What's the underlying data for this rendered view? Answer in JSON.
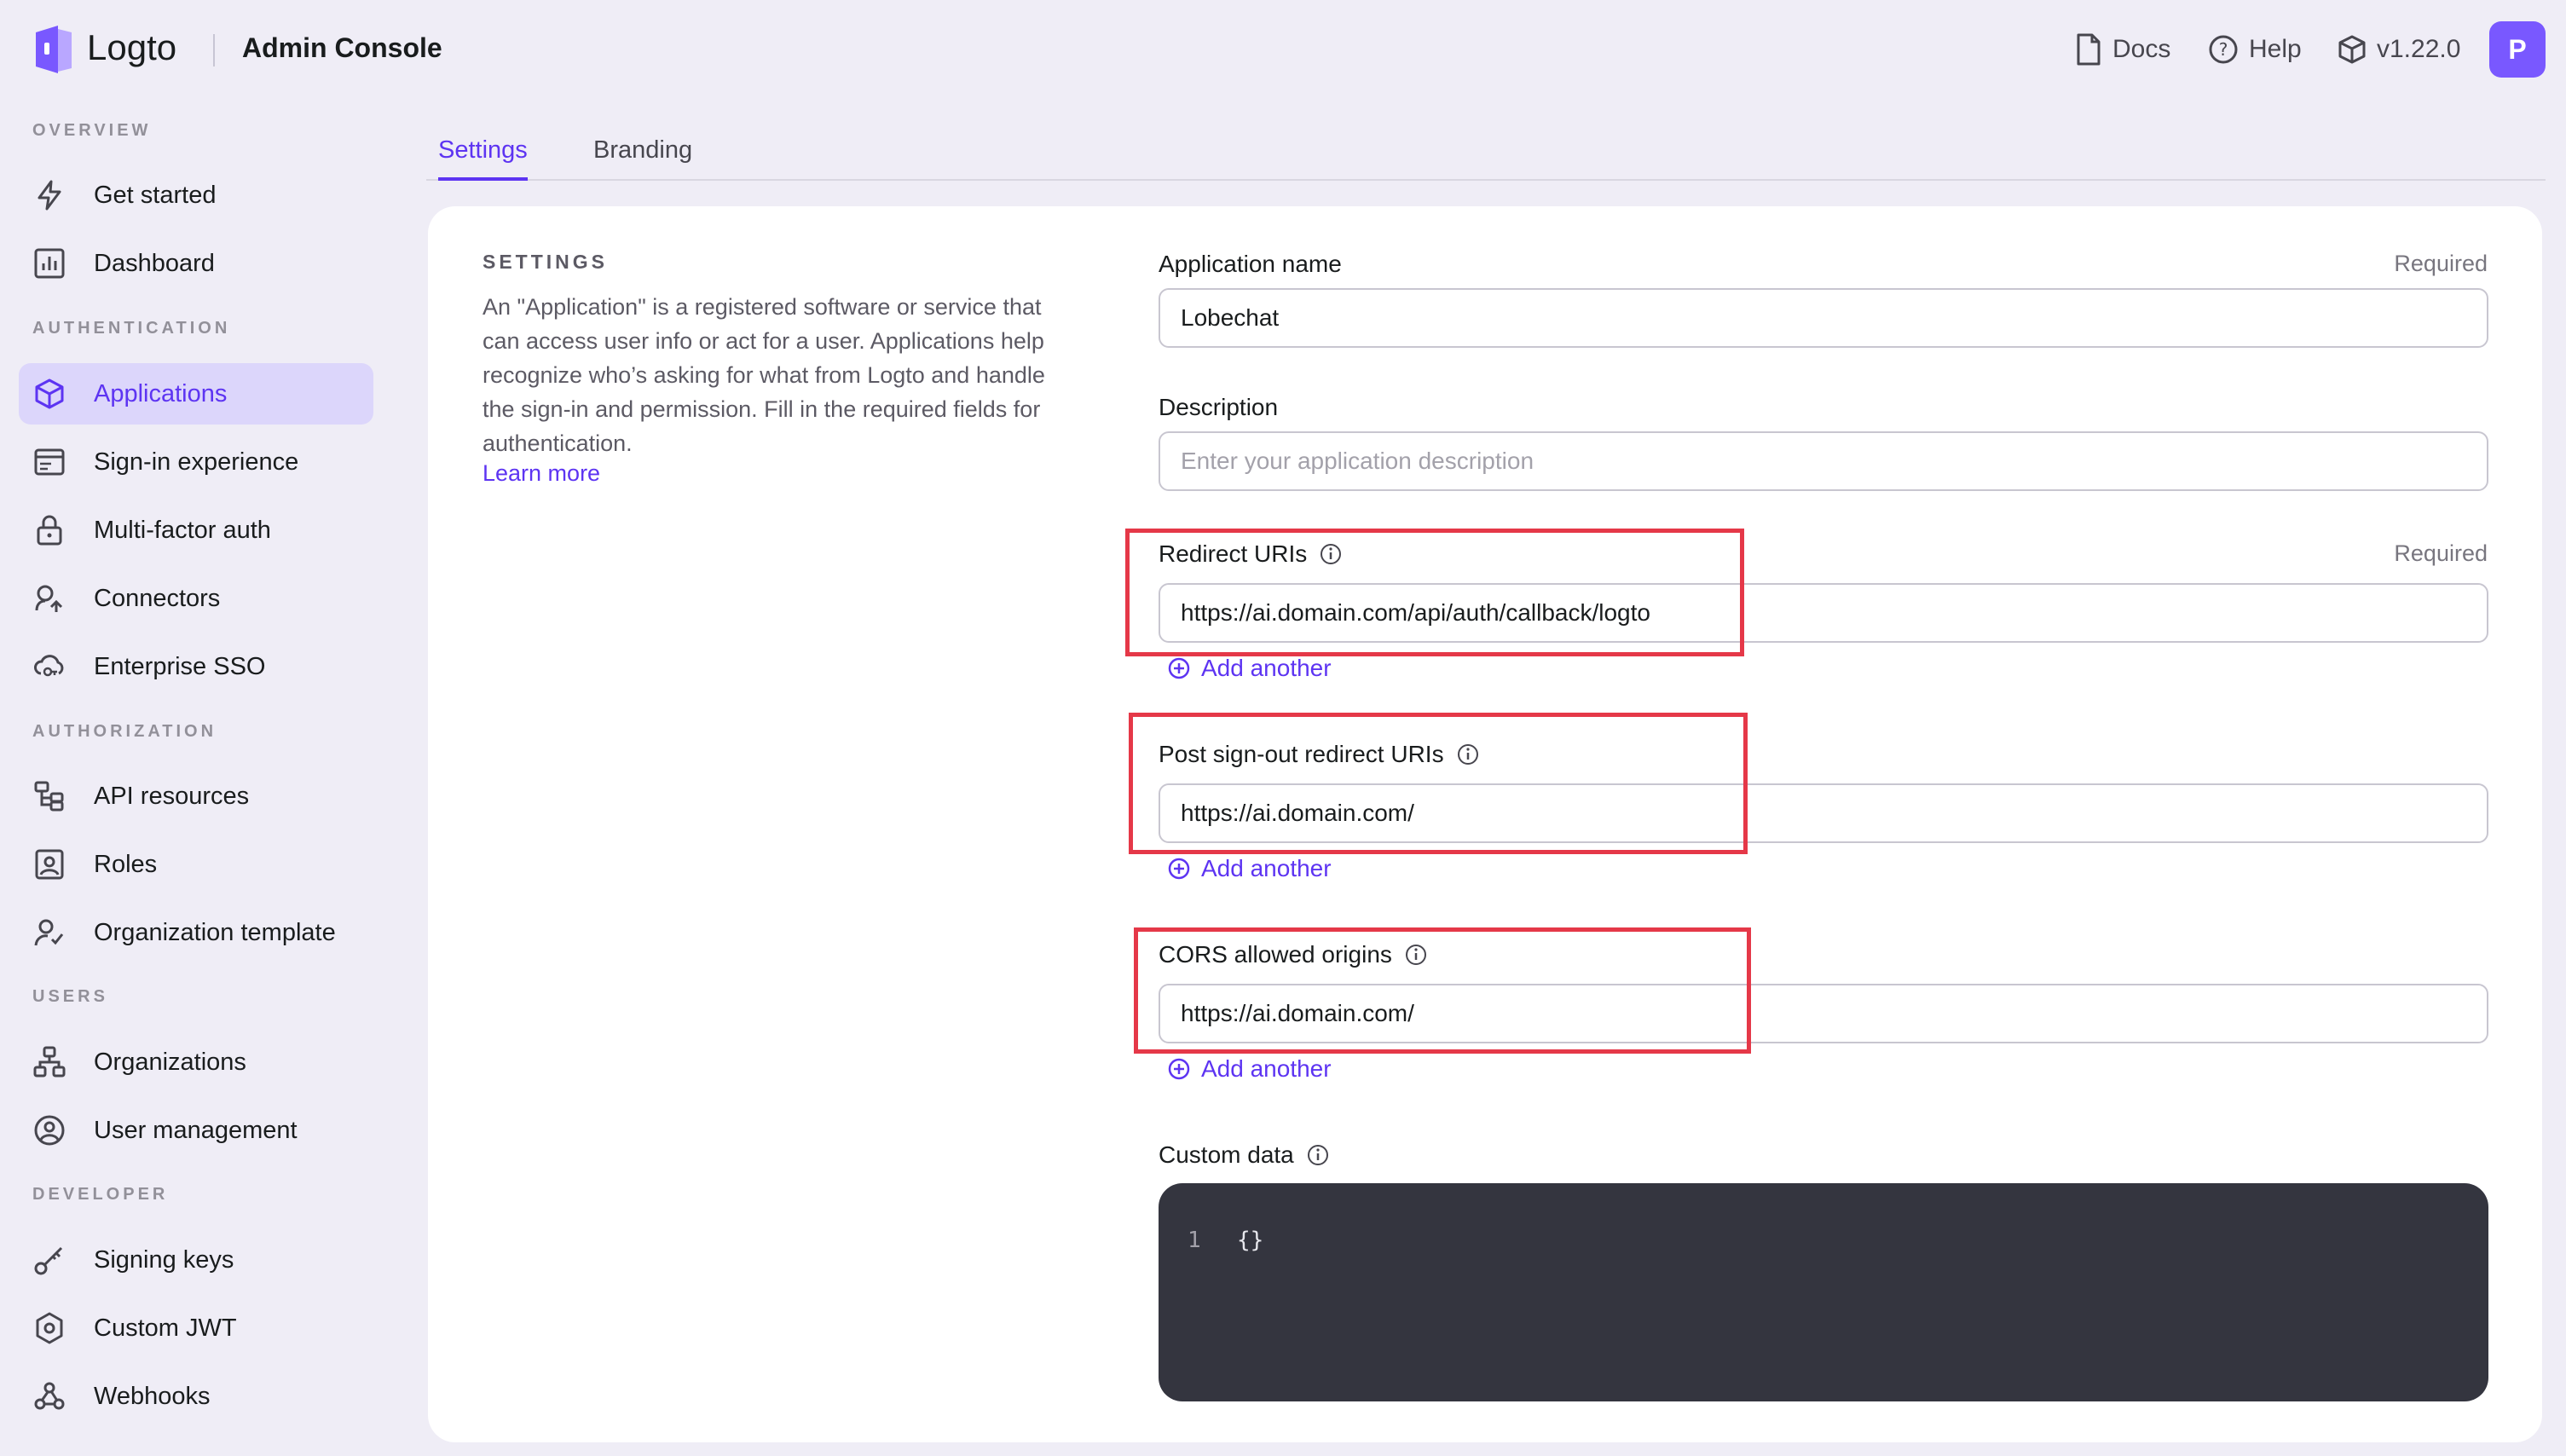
{
  "topbar": {
    "logo_text": "Logto",
    "console_title": "Admin Console",
    "docs_label": "Docs",
    "help_label": "Help",
    "version": "v1.22.0",
    "avatar_initial": "P"
  },
  "sidebar": {
    "sections": {
      "overview": "OVERVIEW",
      "authentication": "AUTHENTICATION",
      "authorization": "AUTHORIZATION",
      "users": "USERS",
      "developer": "DEVELOPER"
    },
    "items": {
      "get_started": "Get started",
      "dashboard": "Dashboard",
      "applications": "Applications",
      "sign_in_experience": "Sign-in experience",
      "multi_factor_auth": "Multi-factor auth",
      "connectors": "Connectors",
      "enterprise_sso": "Enterprise SSO",
      "api_resources": "API resources",
      "roles": "Roles",
      "organization_template": "Organization template",
      "organizations": "Organizations",
      "user_management": "User management",
      "signing_keys": "Signing keys",
      "custom_jwt": "Custom JWT",
      "webhooks": "Webhooks"
    }
  },
  "tabs": {
    "settings": "Settings",
    "branding": "Branding"
  },
  "settings": {
    "title": "SETTINGS",
    "description": "An \"Application\" is a registered software or service that can access user info or act for a user. Applications help recognize who’s asking for what from Logto and handle the sign-in and permission. Fill in the required fields for authentication.",
    "learn_more": "Learn more"
  },
  "form": {
    "app_name": {
      "label": "Application name",
      "required": "Required",
      "value": "Lobechat"
    },
    "description": {
      "label": "Description",
      "placeholder": "Enter your application description"
    },
    "redirect_uris": {
      "label": "Redirect URIs",
      "required": "Required",
      "value": "https://ai.domain.com/api/auth/callback/logto",
      "add_label": "Add another"
    },
    "post_signout": {
      "label": "Post sign-out redirect URIs",
      "value": "https://ai.domain.com/",
      "add_label": "Add another"
    },
    "cors": {
      "label": "CORS allowed origins",
      "value": "https://ai.domain.com/",
      "add_label": "Add another"
    },
    "custom_data": {
      "label": "Custom data",
      "line_number": "1",
      "code": "{}"
    }
  },
  "colors": {
    "accent": "#5d34f2",
    "highlight": "#e53848",
    "background": "#efedf6"
  }
}
